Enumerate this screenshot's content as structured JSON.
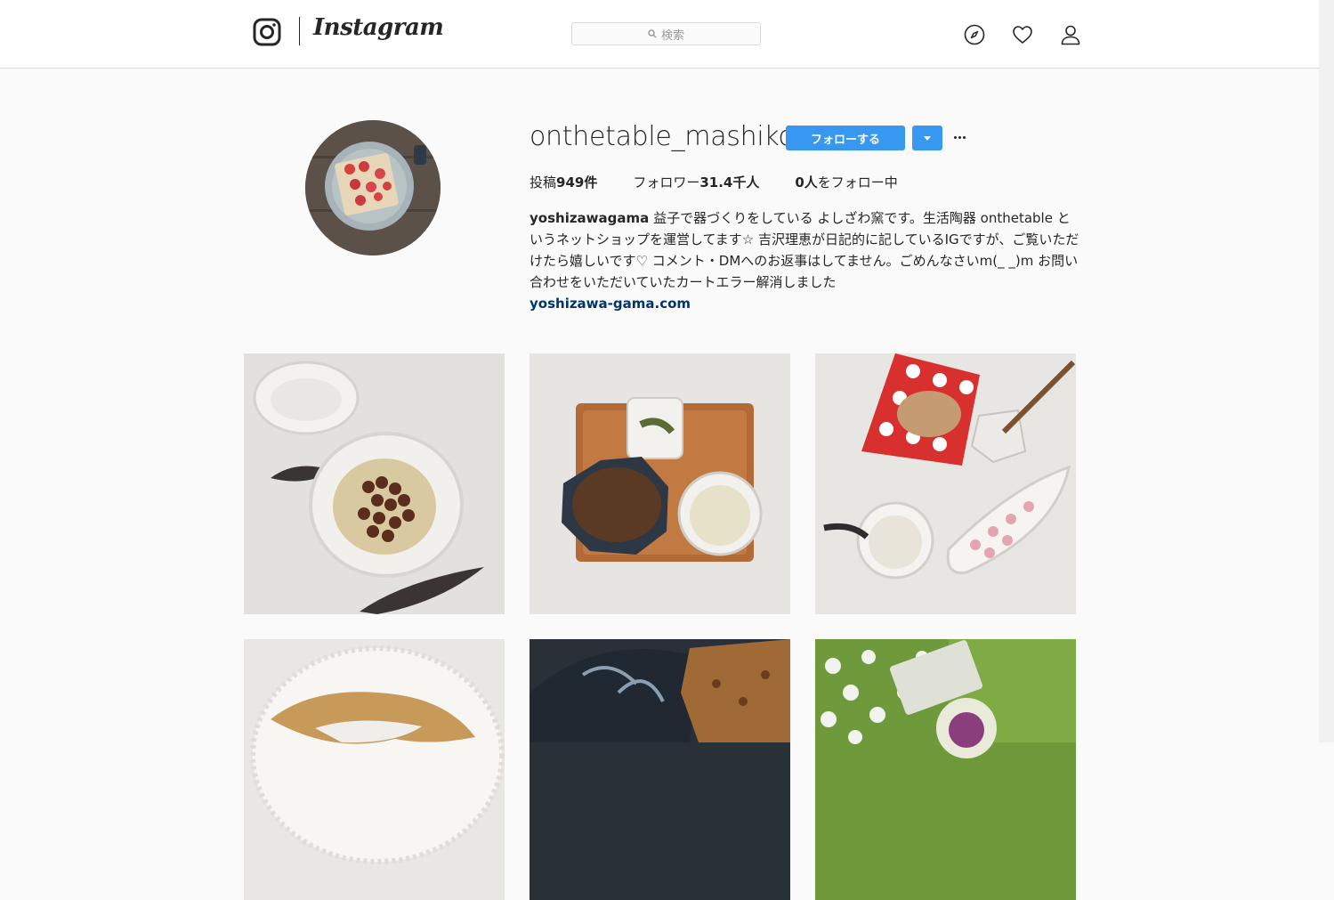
{
  "nav": {
    "brand": "Instagram",
    "search_placeholder": "検索",
    "icons": [
      "camera-logo-icon",
      "compass-icon",
      "heart-icon",
      "user-icon"
    ]
  },
  "profile": {
    "username": "onthetable_mashiko",
    "follow_label": "フォローする",
    "stats": {
      "posts_label": "投稿",
      "posts_value": "949件",
      "followers_label": "フォロワー",
      "followers_value": "31.4千人",
      "following_value": "0人",
      "following_label": "をフォロー中"
    },
    "bio": {
      "name": "yoshizawagama",
      "text": "益子で器づくりをしている よしざわ窯です。生活陶器 onthetable というネットショップを運営してます☆ 吉沢理恵が日記的に記しているIGですが、ご覧いただけたら嬉しいです♡ コメント・DMへのお返事はしてません。ごめんなさいm(_ _)m お問い合わせをいただいていたカートエラー解消しました",
      "link": "yoshizawa-gama.com"
    }
  },
  "colors": {
    "accent": "#3897f0",
    "link": "#003569",
    "text": "#262626",
    "background": "#fafafa"
  },
  "posts": [
    {
      "subject": "white flower bowl with sweet beans"
    },
    {
      "subject": "wooden tray with octagonal bowl and soup"
    },
    {
      "subject": "red polka dot napkin with bread and radish"
    },
    {
      "subject": "lace doily with wooden plate"
    },
    {
      "subject": "dark patterned plate with scone"
    },
    {
      "subject": "garden with green ceramic dish"
    }
  ]
}
